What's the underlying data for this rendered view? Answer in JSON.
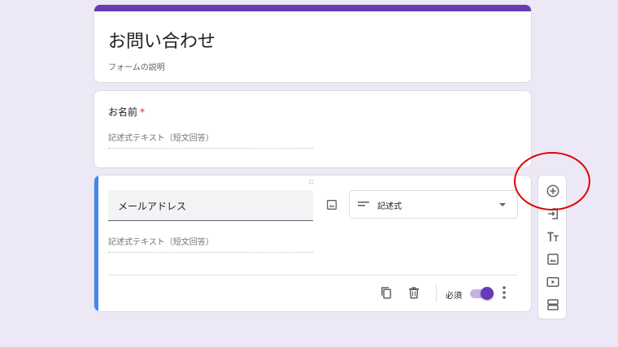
{
  "form": {
    "title": "お問い合わせ",
    "description": "フォームの説明"
  },
  "questions": [
    {
      "title": "お名前",
      "required_mark": "*",
      "answer_placeholder": "記述式テキスト（短文回答）"
    },
    {
      "title": "メールアドレス",
      "answer_placeholder": "記述式テキスト（短文回答）",
      "type_label": "記述式",
      "required_label": "必須",
      "required": true,
      "drag_handle": ":::"
    }
  ],
  "icons": {
    "question_image": "image-icon",
    "type_select": "short-text-icon",
    "dropdown": "dropdown-arrow-icon",
    "copy": "copy-icon",
    "delete": "trash-icon",
    "more": "more-vert-icon"
  },
  "toolbar": {
    "items": [
      "add-question-icon",
      "import-questions-icon",
      "add-title-icon",
      "add-image-icon",
      "add-video-icon",
      "add-section-icon"
    ]
  },
  "colors": {
    "accent": "#673ab7",
    "active_bar": "#4285f4",
    "background": "#ece8f6",
    "required": "#d93025",
    "annotation": "#e00000"
  }
}
